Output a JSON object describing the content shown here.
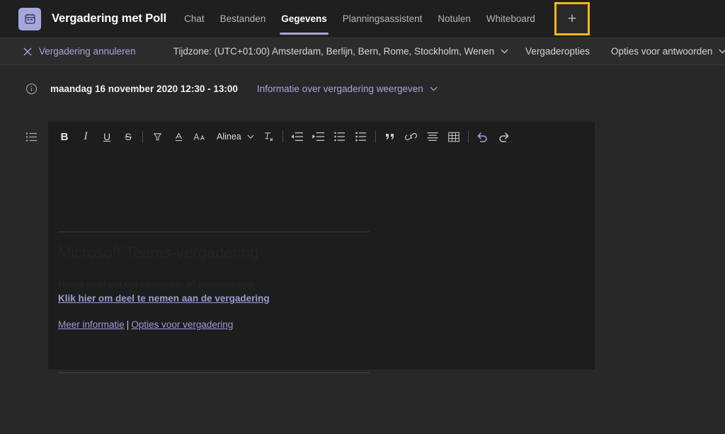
{
  "header": {
    "app_icon": "calendar-icon",
    "title": "Vergadering met Poll",
    "tabs": [
      {
        "label": "Chat",
        "active": false
      },
      {
        "label": "Bestanden",
        "active": false
      },
      {
        "label": "Gegevens",
        "active": true
      },
      {
        "label": "Planningsassistent",
        "active": false
      },
      {
        "label": "Notulen",
        "active": false
      },
      {
        "label": "Whiteboard",
        "active": false
      }
    ],
    "add_tab": {
      "icon": "plus-icon",
      "label": "+",
      "highlight_color": "#f0b81a"
    }
  },
  "command_bar": {
    "cancel": {
      "icon": "close-icon",
      "label": "Vergadering annuleren"
    },
    "timezone": {
      "label": "Tijdzone: (UTC+01:00) Amsterdam, Berlijn, Bern, Rome, Stockholm, Wenen",
      "chevron": "chevron-down-icon"
    },
    "meeting_options": {
      "label": "Vergaderopties"
    },
    "response_options": {
      "label": "Opties voor antwoorden",
      "chevron": "chevron-down-icon"
    }
  },
  "info_row": {
    "icon": "info-icon",
    "date": "maandag 16 november 2020 12:30 - 13:00",
    "link": "Informatie over vergadering weergeven",
    "chevron": "chevron-down-icon"
  },
  "editor": {
    "side_icon": "bullet-list-icon",
    "toolbar": [
      {
        "name": "bold-button",
        "glyph": "B",
        "kind": "bold"
      },
      {
        "name": "italic-button",
        "glyph": "I",
        "kind": "italic"
      },
      {
        "name": "underline-button",
        "glyph": "U",
        "kind": "under"
      },
      {
        "name": "strikethrough-button",
        "glyph": "S",
        "kind": "strike"
      },
      {
        "name": "highlight-button",
        "glyph": "svg-highlight"
      },
      {
        "name": "font-color-button",
        "glyph": "svg-fontcolor"
      },
      {
        "name": "font-size-button",
        "glyph": "svg-fontsize"
      },
      {
        "name": "paragraph-style-select",
        "glyph": "Alinea"
      },
      {
        "name": "clear-formatting-button",
        "glyph": "svg-clearformat"
      },
      {
        "name": "decrease-indent-button",
        "glyph": "svg-outdent"
      },
      {
        "name": "increase-indent-button",
        "glyph": "svg-indent"
      },
      {
        "name": "bulleted-list-button",
        "glyph": "svg-bullets"
      },
      {
        "name": "numbered-list-button",
        "glyph": "svg-numbers"
      },
      {
        "name": "quote-button",
        "glyph": "svg-quote"
      },
      {
        "name": "insert-link-button",
        "glyph": "svg-link"
      },
      {
        "name": "align-button",
        "glyph": "svg-align"
      },
      {
        "name": "insert-table-button",
        "glyph": "svg-table"
      },
      {
        "name": "undo-button",
        "glyph": "svg-undo"
      },
      {
        "name": "redo-button",
        "glyph": "svg-redo"
      }
    ],
    "paragraph_label": "Alinea",
    "body": {
      "ghost_title": "Microsoft Teams-vergadering",
      "ghost_subtitle": "Neem deel via uw computer of mobiele app",
      "join_link": "Klik hier om deel te nemen aan de vergadering",
      "more_info_link": "Meer informatie",
      "separator": "|",
      "meeting_options_link": "Opties voor vergadering"
    }
  },
  "colors": {
    "accent": "#a6a7dc",
    "highlight": "#f0b81a",
    "header_bg": "#201f1f",
    "command_bg": "#2d2c2c",
    "page_bg": "#292828",
    "editor_bg": "#1d1d1d"
  }
}
